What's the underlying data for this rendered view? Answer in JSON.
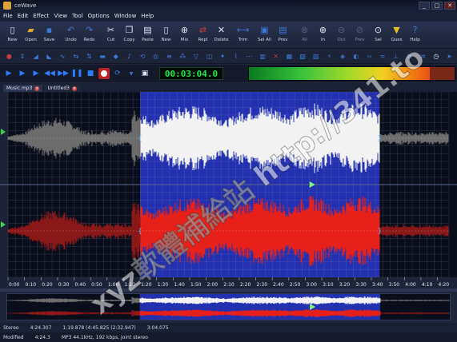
{
  "window": {
    "title": "ceWave",
    "controls": [
      "_",
      "□",
      "✕"
    ]
  },
  "menu": [
    "File",
    "Edit",
    "Effect",
    "View",
    "Tool",
    "Options",
    "Window",
    "Help"
  ],
  "toolbar": [
    {
      "label": "New",
      "icon": "new-icon",
      "color": "#dfe6f4",
      "glyph": "▯"
    },
    {
      "label": "Open",
      "icon": "open-folder-icon",
      "color": "#e0a22f",
      "glyph": "▰"
    },
    {
      "label": "Save",
      "icon": "save-icon",
      "color": "#3c78d8",
      "glyph": "▪"
    },
    {
      "label": "Undo",
      "icon": "undo-icon",
      "color": "#3c78d8",
      "glyph": "↶"
    },
    {
      "label": "Redo",
      "icon": "redo-icon",
      "color": "#3c78d8",
      "glyph": "↷"
    },
    {
      "label": "Cut",
      "icon": "cut-icon",
      "color": "#dfe6f4",
      "glyph": "✂"
    },
    {
      "label": "Copy",
      "icon": "copy-icon",
      "color": "#dfe6f4",
      "glyph": "❐"
    },
    {
      "label": "Paste",
      "icon": "paste-icon",
      "color": "#dfe6f4",
      "glyph": "▤"
    },
    {
      "label": "New",
      "icon": "new-document-icon",
      "color": "#dfe6f4",
      "glyph": "▯"
    },
    {
      "label": "Mix",
      "icon": "mix-icon",
      "color": "#dfe6f4",
      "glyph": "⊕"
    },
    {
      "label": "Repl",
      "icon": "replace-icon",
      "color": "#c83a3a",
      "glyph": "⇄"
    },
    {
      "label": "Delete",
      "icon": "delete-icon",
      "color": "#dfe6f4",
      "glyph": "✕"
    },
    {
      "label": "Trim",
      "icon": "trim-icon",
      "color": "#3c78d8",
      "glyph": "⟷"
    },
    {
      "label": "Sel All",
      "icon": "select-all-icon",
      "color": "#3c78d8",
      "glyph": "▣"
    },
    {
      "label": "Prev",
      "icon": "previous-icon",
      "color": "#3c78d8",
      "glyph": "▤"
    },
    {
      "label": "All",
      "icon": "zoom-all-icon",
      "color": "#8a93a8",
      "glyph": "⊗",
      "dim": true
    },
    {
      "label": "In",
      "icon": "zoom-in-icon",
      "color": "#dfe6f4",
      "glyph": "⊕"
    },
    {
      "label": "Out",
      "icon": "zoom-out-icon",
      "color": "#8a93a8",
      "glyph": "⊖",
      "dim": true
    },
    {
      "label": "Prev",
      "icon": "zoom-previous-icon",
      "color": "#8a93a8",
      "glyph": "⊘",
      "dim": true
    },
    {
      "label": "Sel",
      "icon": "zoom-selection-icon",
      "color": "#dfe6f4",
      "glyph": "⊙"
    },
    {
      "label": "Ques",
      "icon": "cue-icon",
      "color": "#e0c02f",
      "glyph": "▼"
    },
    {
      "label": "Help",
      "icon": "help-icon",
      "color": "#3c78d8",
      "glyph": "?"
    }
  ],
  "effects_toolbar": [
    {
      "icon": "normalize-icon",
      "color": "#c83a3a",
      "glyph": "●"
    },
    {
      "icon": "amplify-icon",
      "color": "#3c78d8",
      "glyph": "⇕"
    },
    {
      "icon": "fade-in-icon",
      "color": "#3c78d8",
      "glyph": "◢"
    },
    {
      "icon": "fade-out-icon",
      "color": "#3c78d8",
      "glyph": "◣"
    },
    {
      "icon": "echo-icon",
      "color": "#3c78d8",
      "glyph": "∿"
    },
    {
      "icon": "reverse-icon",
      "color": "#3c78d8",
      "glyph": "⇆"
    },
    {
      "icon": "invert-icon",
      "color": "#3c78d8",
      "glyph": "⇅"
    },
    {
      "icon": "silence-icon",
      "color": "#3c78d8",
      "glyph": "▬"
    },
    {
      "icon": "insert-silence-icon",
      "color": "#3c78d8",
      "glyph": "◆"
    },
    {
      "icon": "pitch-icon",
      "color": "#3c78d8",
      "glyph": "♪"
    },
    {
      "icon": "tempo-icon",
      "color": "#3c78d8",
      "glyph": "⟲"
    },
    {
      "icon": "reverb-icon",
      "color": "#3c78d8",
      "glyph": "◎"
    },
    {
      "icon": "equalizer-icon",
      "color": "#3c78d8",
      "glyph": "≡"
    },
    {
      "icon": "noise-icon",
      "color": "#3c78d8",
      "glyph": "⁂"
    },
    {
      "icon": "filter-icon",
      "color": "#3c78d8",
      "glyph": "▽"
    },
    {
      "icon": "stereo-icon",
      "color": "#3c78d8",
      "glyph": "◫"
    },
    {
      "icon": "chorus-icon",
      "color": "#3c78d8",
      "glyph": "✦"
    },
    {
      "icon": "flanger-icon",
      "color": "#3c78d8",
      "glyph": "⌇"
    },
    {
      "icon": "delay-icon",
      "color": "#3c78d8",
      "glyph": "⋯"
    },
    {
      "icon": "compressor-icon",
      "color": "#3c78d8",
      "glyph": "▥"
    },
    {
      "icon": "vocal-remove-icon",
      "color": "#c83a3a",
      "glyph": "✕"
    },
    {
      "icon": "spectrum-icon",
      "color": "#3c78d8",
      "glyph": "▦"
    },
    {
      "icon": "band-icon",
      "color": "#3c78d8",
      "glyph": "▧"
    },
    {
      "icon": "gate-icon",
      "color": "#3c78d8",
      "glyph": "▨"
    },
    {
      "icon": "distortion-icon",
      "color": "#3c78d8",
      "glyph": "⚡"
    },
    {
      "icon": "wah-icon",
      "color": "#3c78d8",
      "glyph": "◈"
    },
    {
      "icon": "phaser-icon",
      "color": "#3c78d8",
      "glyph": "◐"
    },
    {
      "icon": "vibrato-icon",
      "color": "#3c78d8",
      "glyph": "∾"
    },
    {
      "icon": "tremolo-icon",
      "color": "#3c78d8",
      "glyph": "≈"
    },
    {
      "icon": "dc-offset-icon",
      "color": "#3c78d8",
      "glyph": "⊥"
    },
    {
      "icon": "resample-icon",
      "color": "#3c78d8",
      "glyph": "⧉"
    },
    {
      "icon": "convert-icon",
      "color": "#3c78d8",
      "glyph": "⇌"
    },
    {
      "icon": "clock-icon",
      "color": "#dfe6f4",
      "glyph": "◷"
    },
    {
      "icon": "arrow-right-icon",
      "color": "#3c78d8",
      "glyph": "➤"
    }
  ],
  "transport": {
    "buttons": [
      {
        "name": "play-icon",
        "glyph": "▶"
      },
      {
        "name": "play-from-start-icon",
        "glyph": "▶"
      },
      {
        "name": "play-selection-icon",
        "glyph": "▶"
      },
      {
        "name": "rewind-icon",
        "glyph": "◀◀"
      },
      {
        "name": "fast-forward-icon",
        "glyph": "▶▶"
      },
      {
        "name": "pause-icon",
        "glyph": "❚❚"
      },
      {
        "name": "stop-icon",
        "glyph": "■"
      }
    ],
    "time": "00:03:04.0"
  },
  "tabs": [
    {
      "label": "Music.mp3"
    },
    {
      "label": "Untitled3"
    }
  ],
  "timeline": {
    "ticks": [
      "0:00",
      "0:10",
      "0:20",
      "0:30",
      "0:40",
      "0:50",
      "1:00",
      "1:10",
      "1:20",
      "1:30",
      "1:40",
      "1:50",
      "2:00",
      "2:10",
      "2:20",
      "2:30",
      "2:40",
      "2:50",
      "3:00",
      "3:10",
      "3:20",
      "3:30",
      "3:40",
      "3:50",
      "4:00",
      "4:10",
      "4:20"
    ],
    "total_seconds": 267,
    "selection_start_seconds": 80,
    "selection_end_seconds": 225,
    "cursor_seconds": 184
  },
  "statusbar": {
    "row1": [
      "Stereo",
      "4:24.307",
      "1:19.878 (4:45.825 (2:32.947)",
      "3:04.075"
    ],
    "row2": [
      "Modified",
      "4:24.3",
      "MP3 44.1kHz, 192 kbps, joint stereo"
    ]
  },
  "colors": {
    "selection": "#2330b0",
    "left_wave": "#f2f2f2",
    "right_wave": "#e8201a",
    "background": "#0a0e1a"
  },
  "watermark": "xyz軟體補給站 http://341.to"
}
